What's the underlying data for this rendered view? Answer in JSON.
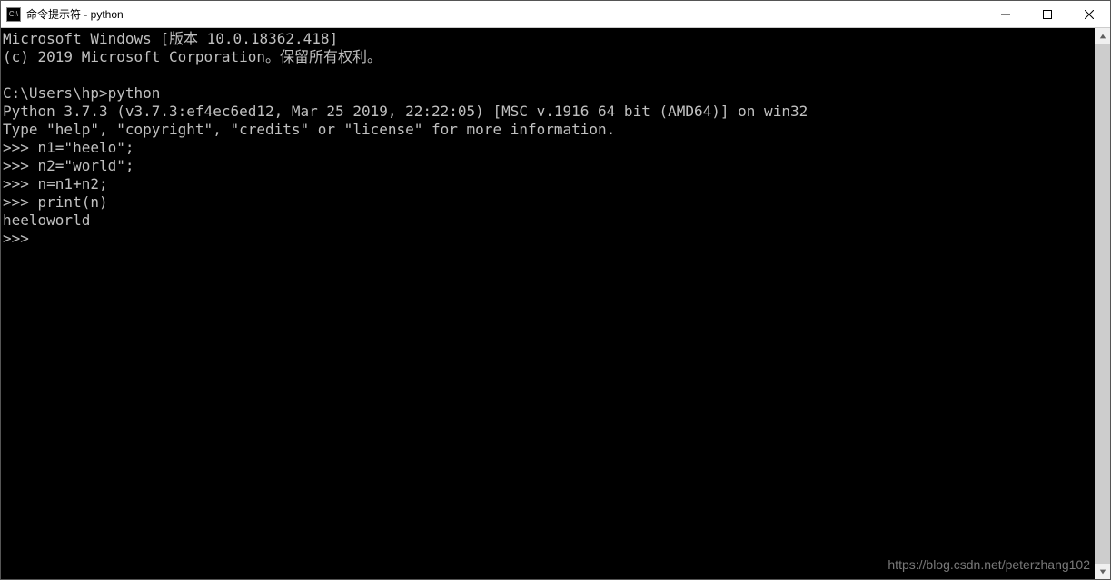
{
  "titlebar": {
    "icon_label": "C:\\",
    "title": "命令提示符 - python"
  },
  "terminal": {
    "lines": [
      "Microsoft Windows [版本 10.0.18362.418]",
      "(c) 2019 Microsoft Corporation。保留所有权利。",
      "",
      "C:\\Users\\hp>python",
      "Python 3.7.3 (v3.7.3:ef4ec6ed12, Mar 25 2019, 22:22:05) [MSC v.1916 64 bit (AMD64)] on win32",
      "Type \"help\", \"copyright\", \"credits\" or \"license\" for more information.",
      ">>> n1=\"heelo\";",
      ">>> n2=\"world\";",
      ">>> n=n1+n2;",
      ">>> print(n)",
      "heeloworld",
      ">>>"
    ]
  },
  "watermark": "https://blog.csdn.net/peterzhang102"
}
